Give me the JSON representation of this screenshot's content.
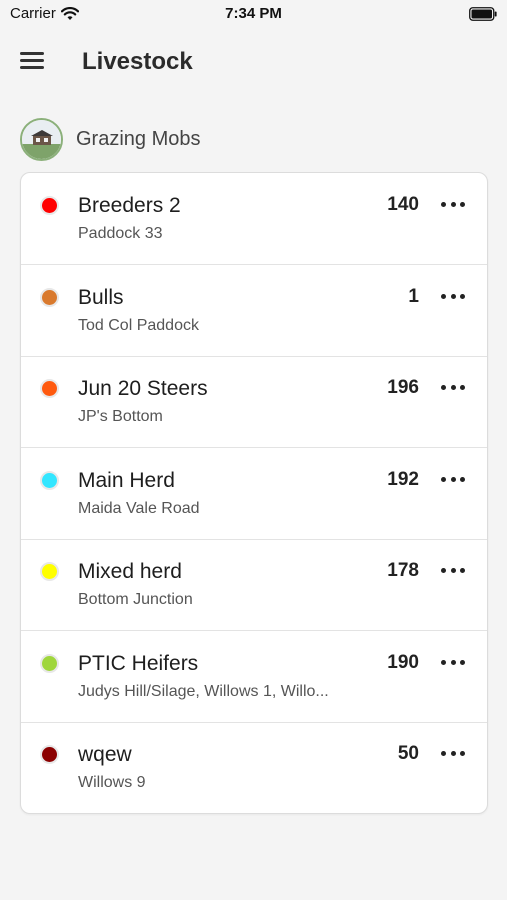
{
  "status_bar": {
    "carrier": "Carrier",
    "time": "7:34 PM"
  },
  "header": {
    "title": "Livestock"
  },
  "section": {
    "title": "Grazing Mobs"
  },
  "mobs": [
    {
      "name": "Breeders 2",
      "location": "Paddock 33",
      "count": "140",
      "color": "#ff0000"
    },
    {
      "name": "Bulls",
      "location": "Tod Col Paddock",
      "count": "1",
      "color": "#d97a2e"
    },
    {
      "name": "Jun 20 Steers",
      "location": "JP's Bottom",
      "count": "196",
      "color": "#ff5a0f"
    },
    {
      "name": "Main Herd",
      "location": "Maida Vale Road",
      "count": "192",
      "color": "#33e6ff"
    },
    {
      "name": "Mixed herd",
      "location": "Bottom Junction",
      "count": "178",
      "color": "#ffff00"
    },
    {
      "name": "PTIC Heifers",
      "location": "Judys Hill/Silage, Willows 1, Willo...",
      "count": "190",
      "color": "#9fd63c"
    },
    {
      "name": "wqew",
      "location": "Willows 9",
      "count": "50",
      "color": "#8b0000"
    }
  ]
}
